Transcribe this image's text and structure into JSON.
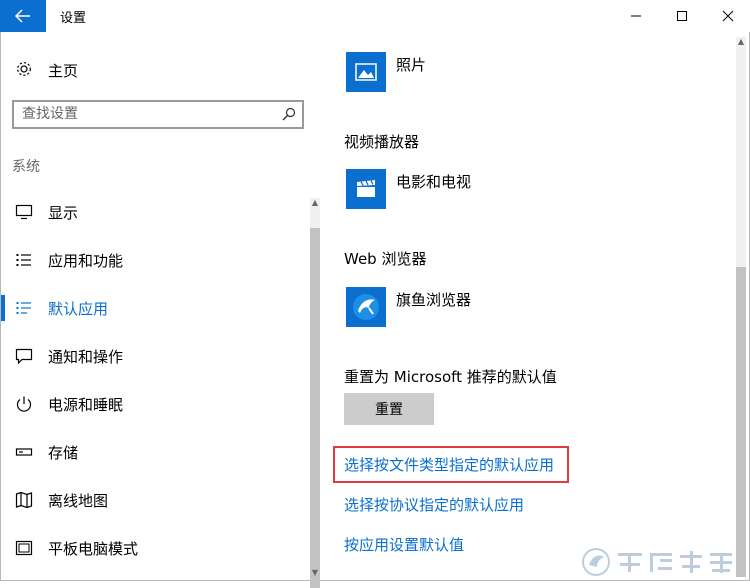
{
  "window": {
    "title": "设置",
    "back_icon": "back-arrow-icon",
    "controls": [
      "minimize-icon",
      "maximize-icon",
      "close-icon"
    ]
  },
  "sidebar": {
    "home_label": "主页",
    "home_icon": "gear-icon",
    "search": {
      "placeholder": "查找设置",
      "icon": "search-icon"
    },
    "section_label": "系统",
    "items": [
      {
        "label": "显示",
        "icon": "monitor-icon"
      },
      {
        "label": "应用和功能",
        "icon": "list-icon"
      },
      {
        "label": "默认应用",
        "icon": "default-apps-icon",
        "selected": true
      },
      {
        "label": "通知和操作",
        "icon": "notification-icon"
      },
      {
        "label": "电源和睡眠",
        "icon": "power-icon"
      },
      {
        "label": "存储",
        "icon": "storage-icon"
      },
      {
        "label": "离线地图",
        "icon": "map-icon"
      },
      {
        "label": "平板电脑模式",
        "icon": "tablet-icon"
      }
    ]
  },
  "main": {
    "photos_app": {
      "name": "照片",
      "icon": "photos-icon"
    },
    "video_heading": "视频播放器",
    "video_app": {
      "name": "电影和电视",
      "icon": "movies-tv-icon"
    },
    "browser_heading": "Web 浏览器",
    "browser_app": {
      "name": "旗鱼浏览器",
      "icon": "browser-icon"
    },
    "reset_heading": "重置为 Microsoft 推荐的默认值",
    "reset_button": "重置",
    "links": [
      "选择按文件类型指定的默认应用",
      "选择按协议指定的默认应用",
      "按应用设置默认值"
    ]
  },
  "colors": {
    "accent": "#0a6fcf",
    "highlight_box": "#e0393e",
    "reset_button_bg": "#cccccc"
  },
  "watermark": "系统之家"
}
